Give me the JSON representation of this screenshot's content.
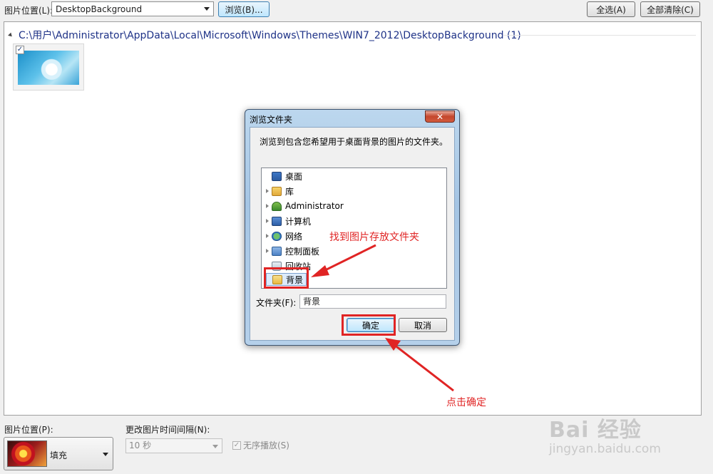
{
  "top": {
    "location_label": "图片位置(L):",
    "location_value": "DesktopBackground",
    "browse_button": "浏览(B)...",
    "select_all_button": "全选(A)",
    "clear_all_button": "全部清除(C)"
  },
  "gallery": {
    "group_path": "C:\\用户\\Administrator\\AppData\\Local\\Microsoft\\Windows\\Themes\\WIN7_2012\\DesktopBackground (1)",
    "thumb_checked": "✓"
  },
  "dialog": {
    "title": "浏览文件夹",
    "close_glyph": "✕",
    "description": "浏览到包含您希望用于桌面背景的图片的文件夹。",
    "tree_items": [
      {
        "label": "桌面"
      },
      {
        "label": "库"
      },
      {
        "label": "Administrator"
      },
      {
        "label": "计算机"
      },
      {
        "label": "网络"
      },
      {
        "label": "控制面板"
      },
      {
        "label": "回收站"
      },
      {
        "label": "背景"
      }
    ],
    "folder_label": "文件夹(F):",
    "folder_value": "背景",
    "ok_button": "确定",
    "cancel_button": "取消"
  },
  "annotations": {
    "find_folder": "找到图片存放文件夹",
    "click_ok": "点击确定",
    "color": "#e02424"
  },
  "bottom": {
    "position_label": "图片位置(P):",
    "position_value": "填充",
    "interval_label": "更改图片时间间隔(N):",
    "interval_value": "10 秒",
    "shuffle_label": "无序播放(S)",
    "shuffle_check": "✓"
  },
  "watermark": {
    "brand": "Bai 经验",
    "url": "jingyan.baidu.com"
  }
}
